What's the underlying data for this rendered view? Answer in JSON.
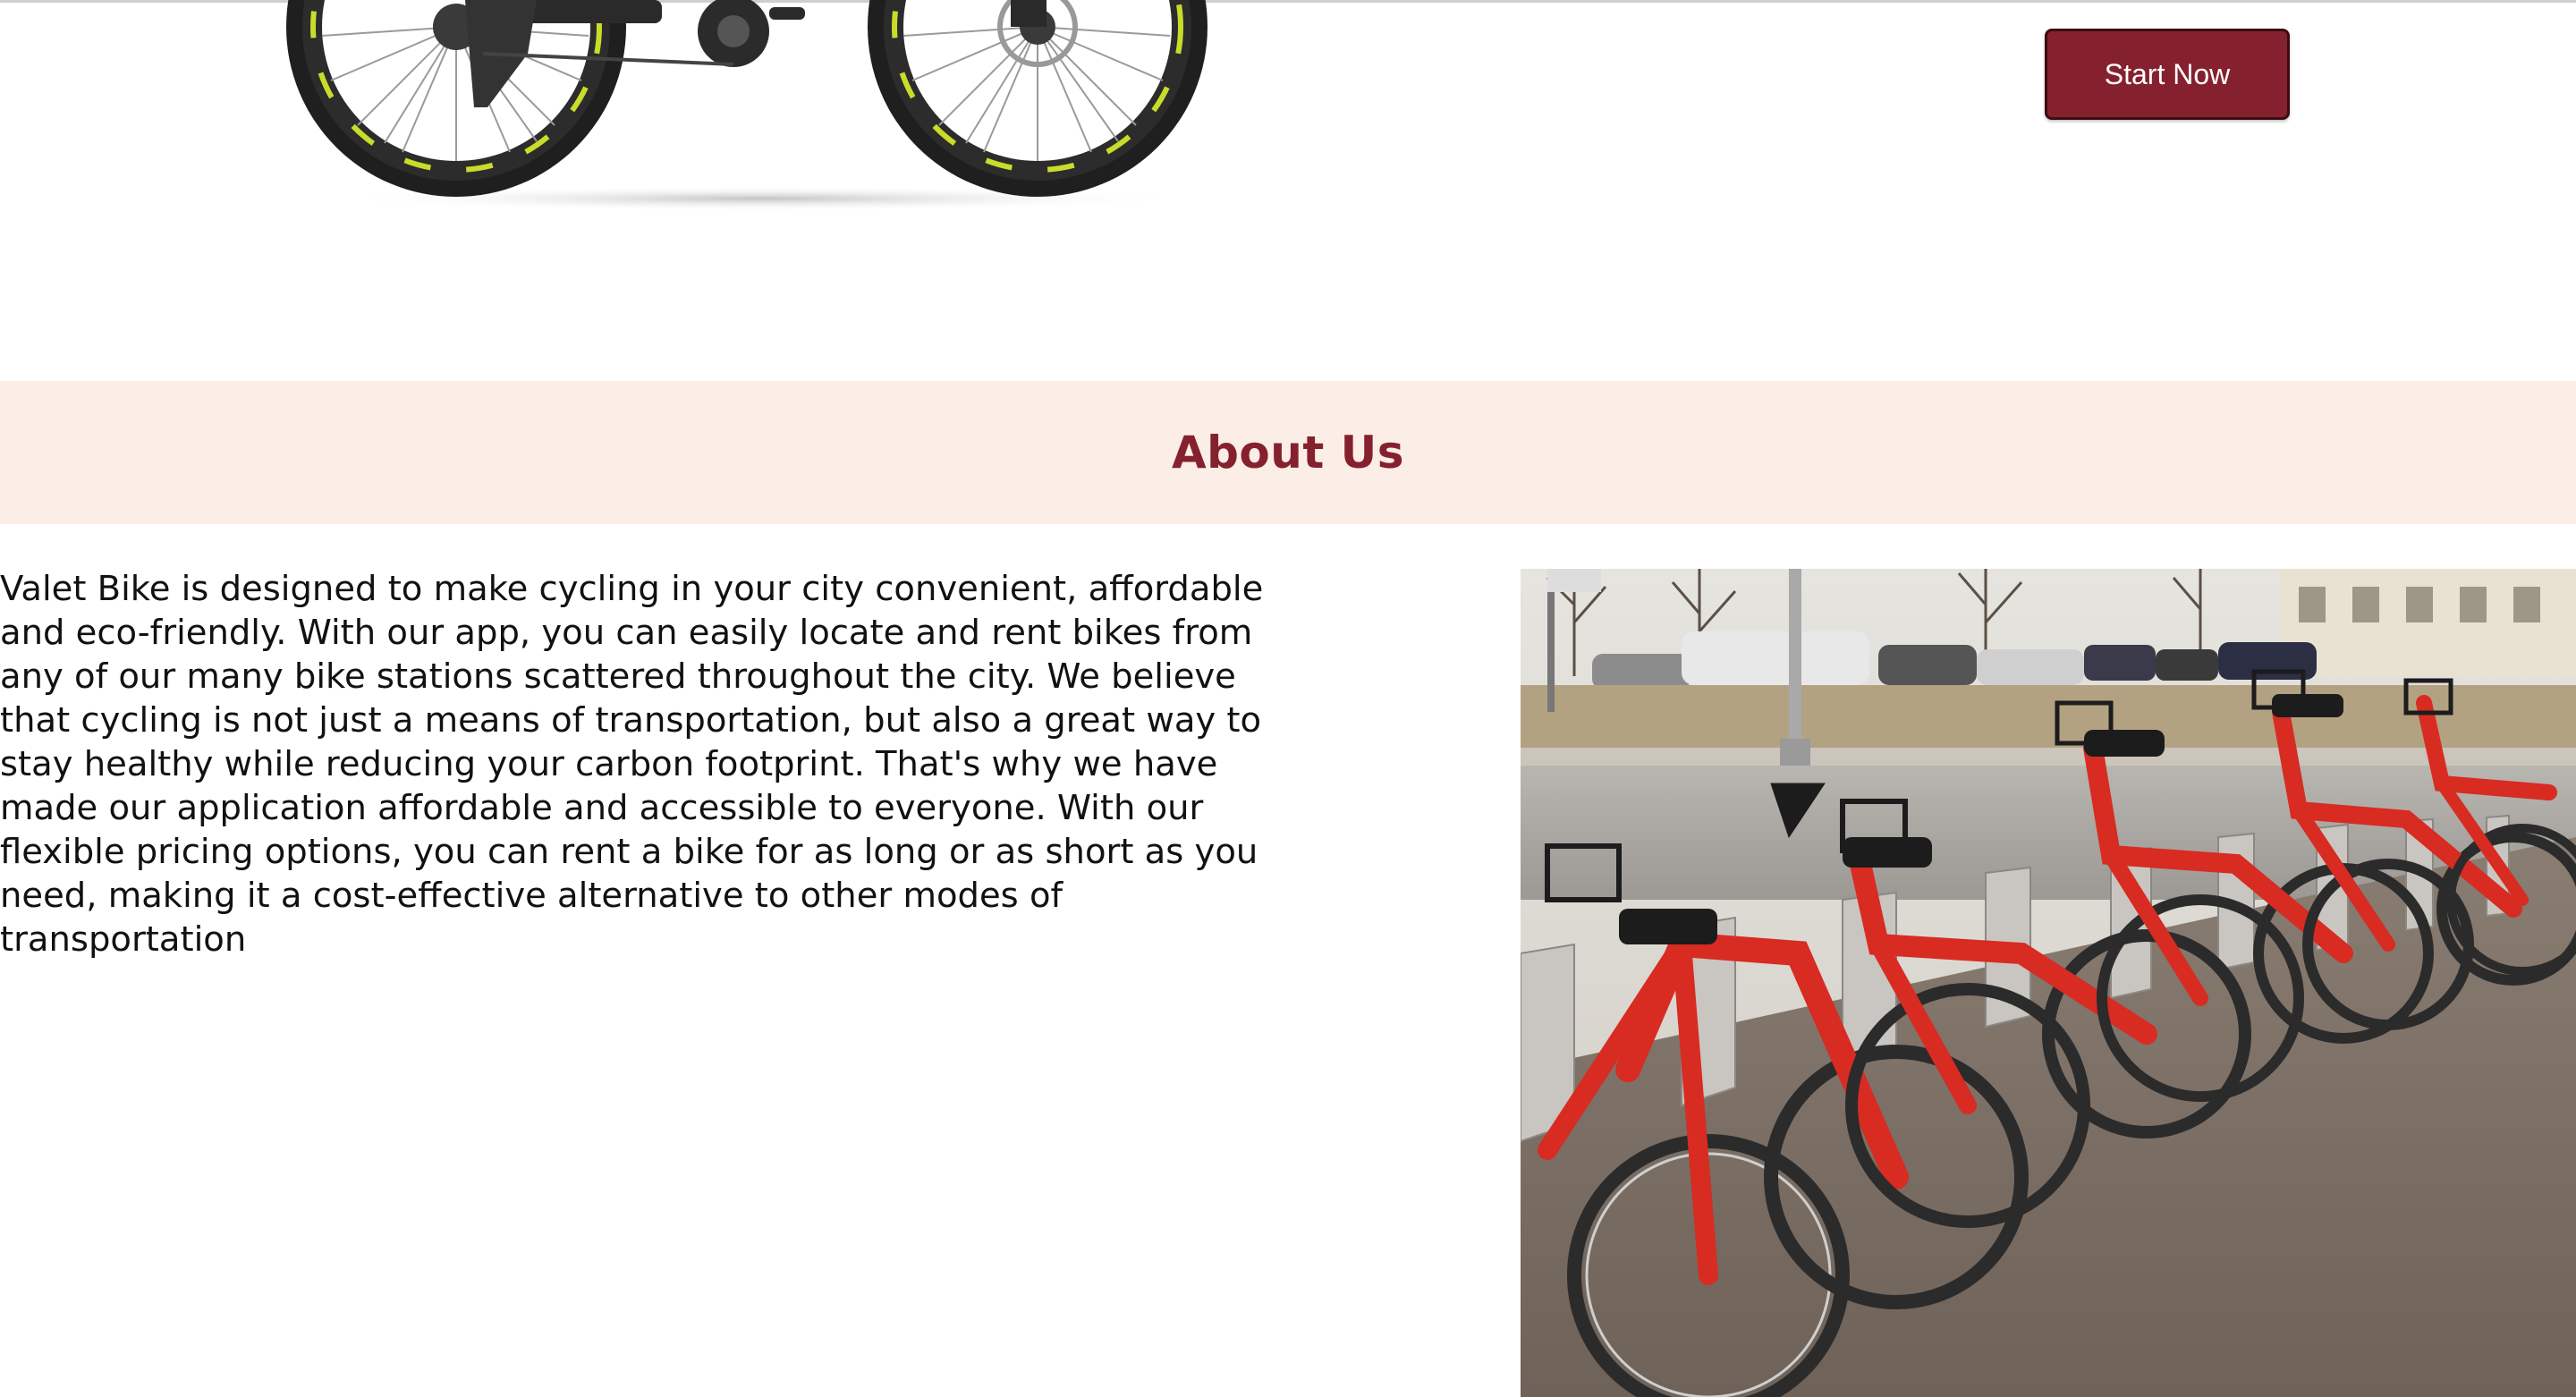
{
  "hero": {
    "start_label": "Start Now"
  },
  "about": {
    "title": "About Us",
    "body": "Valet Bike is designed to make cycling in your city convenient, affordable and eco-friendly. With our app, you can easily locate and rent bikes from any of our many bike stations scattered throughout the city. We believe that cycling is not just a means of transportation, but also a great way to stay healthy while reducing your carbon footprint. That's why we have made our application affordable and accessible to everyone. With our flexible pricing options, you can rent a bike for as long or as short as you need, making it a cost-effective alternative to other modes of transportation"
  },
  "colors": {
    "brand": "#85212e",
    "band_bg": "#faeee6",
    "bike_frame": "#d82b22",
    "tire_accent": "#c9dc2a"
  }
}
